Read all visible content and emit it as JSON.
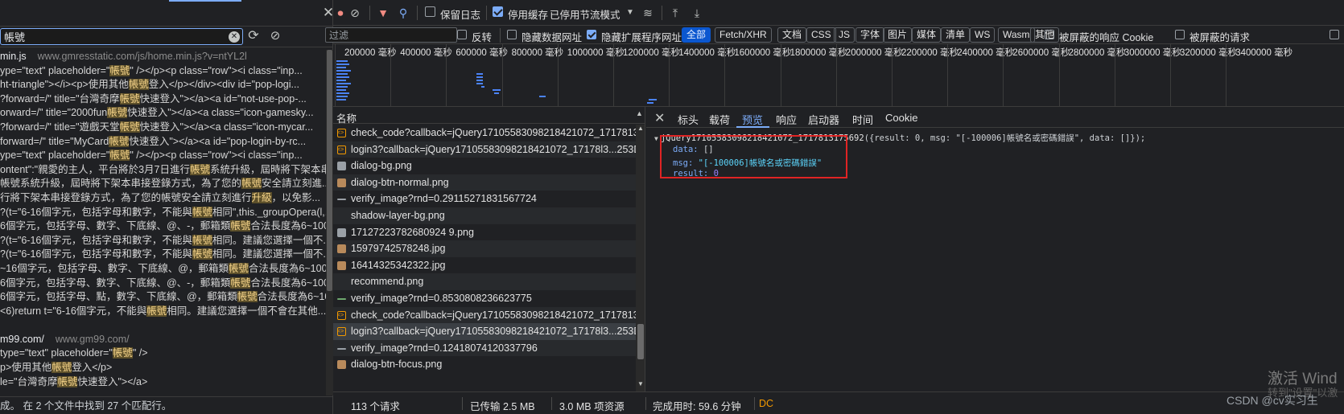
{
  "search": {
    "query": "帳號",
    "status": "成。 在 2 个文件中找到 27 个匹配行。",
    "files": [
      {
        "name": "min.js",
        "url": "www.gmresstatic.com/js/home.min.js?v=ntYL2l",
        "lines": [
          [
            "ype=\"text\" placeholder=\"",
            "帳號",
            "\" /></p><p class=\"row\"><i class=\"inp..."
          ],
          [
            "ht-triangle\"></i><p>使用其他",
            "帳號",
            "登入</p></div><div id=\"pop-logi..."
          ],
          [
            "?forward=/\" title=\"台灣奇摩",
            "帳號",
            "快速登入\"></a><a id=\"not-use-pop-..."
          ],
          [
            "orward=/\" title=\"2000fun",
            "帳號",
            "快速登入\"></a><a class=\"icon-gamesky..."
          ],
          [
            "?forward=/\" title=\"遊戲天堂",
            "帳號",
            "快速登入\"></a><a class=\"icon-mycar..."
          ],
          [
            "forward=/\" title=\"MyCard",
            "帳號",
            "快速登入\"></a><a id=\"pop-login-by-rc..."
          ],
          [
            "ype=\"text\" placeholder=\"",
            "帳號",
            "\" /></p><p class=\"row\"><i class=\"inp..."
          ],
          [
            "ontent\":\"親愛的主人，平台將於3月7日進行",
            "帳號",
            "系統升級，屆時將下架本串..."
          ],
          [
            "帳號系統升級，屆時將下架本串接登錄方式，為了您的",
            "帳號",
            "安全請立刻進..."
          ],
          [
            "行將下架本串接登錄方式，為了您的帳號安全請立刻進行",
            "升級",
            "，以免影..."
          ],
          [
            "?(t=\"6-16個字元，包括字母和數字，不能與",
            "帳號",
            "相同\",this._groupOpera(l,..."
          ],
          [
            "6個字元，包括字母、數字、下底線、@、-，郵箱類",
            "帳號",
            "合法長度為6~100..."
          ],
          [
            "?(t=\"6-16個字元，包括字母和數字，不能與",
            "帳號",
            "相同。建議您選擇一個不..."
          ],
          [
            "?(t=\"6-16個字元，包括字母和數字，不能與",
            "帳號",
            "相同。建議您選擇一個不..."
          ],
          [
            "~16個字元，包括字母、數字、下底線、@，郵箱類",
            "帳號",
            "合法長度為6~100..."
          ],
          [
            "6個字元，包括字母、數字、下底線、@、-，郵箱類",
            "帳號",
            "合法長度為6~100..."
          ],
          [
            "6個字元，包括字母、點，數字、下底線、@，郵箱類",
            "帳號",
            "合法長度為6~100..."
          ],
          [
            "<6)return t=\"6-16個字元，不能與",
            "帳號",
            "相同。建議您選擇一個不會在其他..."
          ]
        ]
      },
      {
        "name": "m99.com/",
        "url": "www.gm99.com/",
        "lines": [
          [
            "type=\"text\" placeholder=\"",
            "帳號",
            "\" />"
          ],
          [
            "p>使用其他",
            "帳號",
            "登入</p>"
          ],
          [
            "le=\"台灣奇摩",
            "帳號",
            "快速登入\"></a>"
          ]
        ]
      }
    ]
  },
  "toolbar": {
    "preserve_log": "保留日志",
    "disable_cache": "停用缓存",
    "throttle": "已停用节流模式"
  },
  "filter": {
    "placeholder": "过滤",
    "invert": "反转",
    "hide_data_urls": "隐藏数据网址",
    "hide_ext_urls": "隐藏扩展程序网址",
    "types": [
      "全部",
      "Fetch/XHR",
      "文档",
      "CSS",
      "JS",
      "字体",
      "图片",
      "媒体",
      "清单",
      "WS",
      "Wasm",
      "其他"
    ],
    "blocked_cookies": "被屏蔽的响应 Cookie",
    "blocked_requests": "被屏蔽的请求"
  },
  "timeline": {
    "ticks": [
      "200000 毫秒",
      "400000 毫秒",
      "600000 毫秒",
      "800000 毫秒",
      "1000000 毫秒",
      "1200000 毫秒",
      "1400000 毫秒",
      "1600000 毫秒",
      "1800000 毫秒",
      "2000000 毫秒",
      "2200000 毫秒",
      "2400000 毫秒",
      "2600000 毫秒",
      "2800000 毫秒",
      "3000000 毫秒",
      "3200000 毫秒",
      "3400000 毫秒"
    ]
  },
  "requests": {
    "header": "名称",
    "rows": [
      {
        "name": "check_code?callback=jQuery17105583098218421072_171781317...",
        "icon": "script"
      },
      {
        "name": "login3?callback=jQuery17105583098218421072_17178l3...253D...",
        "icon": "script"
      },
      {
        "name": "dialog-bg.png",
        "icon": "image"
      },
      {
        "name": "dialog-btn-normal.png",
        "icon": "image-orange"
      },
      {
        "name": "verify_image?rnd=0.29115271831567724",
        "icon": "other"
      },
      {
        "name": "shadow-layer-bg.png",
        "icon": "blank"
      },
      {
        "name": "17127223782680924 9.png",
        "icon": "image"
      },
      {
        "name": "15979742578248.jpg",
        "icon": "image-orange"
      },
      {
        "name": "16414325342322.jpg",
        "icon": "image-orange"
      },
      {
        "name": "recommend.png",
        "icon": "blank"
      },
      {
        "name": "verify_image?rnd=0.8530808236623775",
        "icon": "green"
      },
      {
        "name": "check_code?callback=jQuery17105583098218421072_171781317...",
        "icon": "script"
      },
      {
        "name": "login3?callback=jQuery17105583098218421072_17178l3...253D...",
        "icon": "script"
      },
      {
        "name": "verify_image?rnd=0.12418074120337796",
        "icon": "other"
      },
      {
        "name": "dialog-btn-focus.png",
        "icon": "image-orange"
      }
    ]
  },
  "details": {
    "tabs": [
      "标头",
      "载荷",
      "预览",
      "响应",
      "启动器",
      "时间",
      "Cookie"
    ],
    "active_tab": "预览",
    "preview": {
      "root_fn": "jQuery17105583098218421072_1717813175692",
      "root_body": "({result: 0, msg: \"[-100006]帳號名或密碼錯誤\", data: []});",
      "data_key": "data:",
      "data_val": "[]",
      "msg_key": "msg:",
      "msg_val": "\"[-100006]帳號名或密碼錯誤\"",
      "result_key": "result:",
      "result_val": "0"
    }
  },
  "status": {
    "requests": "113 个请求",
    "transferred": "已传输 2.5 MB",
    "resources": "3.0 MB 项资源",
    "finish": "完成用时: 59.6 分钟",
    "dom": "DC"
  },
  "watermark": {
    "line1": "激活 Wind",
    "line2": "转到\"设置\"以激",
    "csdn": "CSDN @cv实习生"
  },
  "colors": {
    "accent": "#7cacf8",
    "highlight_box": "#e02424",
    "match_bg": "#5c4f2a",
    "active_type": "#0b57d0"
  }
}
